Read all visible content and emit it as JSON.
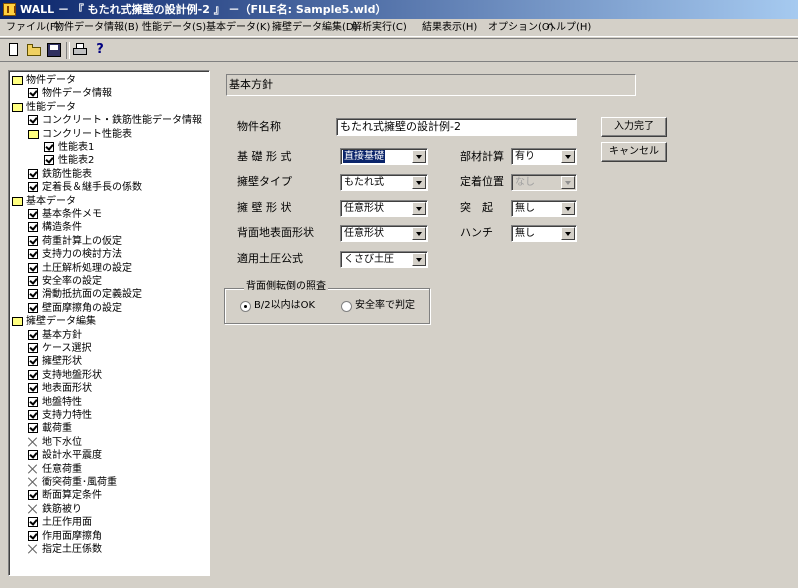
{
  "window": {
    "title": "WALL － 『 もたれ式擁壁の設計例-2 』 －（FILE名: Sample5.wld）"
  },
  "menu": [
    "ファイル(F)",
    "物件データ情報(B)",
    "性能データ(S)",
    "基本データ(K)",
    "擁壁データ編集(D)",
    "解析実行(C)",
    "結果表示(H)",
    "オプション(O)",
    "ヘルプ(H)"
  ],
  "tree": [
    {
      "label": "物件データ",
      "icon": "folder",
      "level": 0
    },
    {
      "label": "物件データ情報",
      "icon": "check",
      "level": 1
    },
    {
      "label": "性能データ",
      "icon": "folder",
      "level": 0
    },
    {
      "label": "コンクリート・鉄筋性能データ情報",
      "icon": "check",
      "level": 1
    },
    {
      "label": "コンクリート性能表",
      "icon": "folder",
      "level": 1
    },
    {
      "label": "性能表1",
      "icon": "check",
      "level": 2
    },
    {
      "label": "性能表2",
      "icon": "check",
      "level": 2
    },
    {
      "label": "鉄筋性能表",
      "icon": "check",
      "level": 1
    },
    {
      "label": "定着長＆継手長の係数",
      "icon": "check",
      "level": 1
    },
    {
      "label": "基本データ",
      "icon": "folder",
      "level": 0
    },
    {
      "label": "基本条件メモ",
      "icon": "check",
      "level": 1
    },
    {
      "label": "構造条件",
      "icon": "check",
      "level": 1
    },
    {
      "label": "荷重計算上の仮定",
      "icon": "check",
      "level": 1
    },
    {
      "label": "支持力の検討方法",
      "icon": "check",
      "level": 1
    },
    {
      "label": "土圧解析処理の設定",
      "icon": "check",
      "level": 1
    },
    {
      "label": "安全率の設定",
      "icon": "check",
      "level": 1
    },
    {
      "label": "滑動抵抗面の定義設定",
      "icon": "check",
      "level": 1
    },
    {
      "label": "壁面摩擦角の設定",
      "icon": "check",
      "level": 1
    },
    {
      "label": "擁壁データ編集",
      "icon": "folder",
      "level": 0
    },
    {
      "label": "基本方針",
      "icon": "check",
      "level": 1
    },
    {
      "label": "ケース選択",
      "icon": "check",
      "level": 1
    },
    {
      "label": "擁壁形状",
      "icon": "check",
      "level": 1
    },
    {
      "label": "支持地盤形状",
      "icon": "check",
      "level": 1
    },
    {
      "label": "地表面形状",
      "icon": "check",
      "level": 1
    },
    {
      "label": "地盤特性",
      "icon": "check",
      "level": 1
    },
    {
      "label": "支持力特性",
      "icon": "check",
      "level": 1
    },
    {
      "label": "載荷重",
      "icon": "check",
      "level": 1
    },
    {
      "label": "地下水位",
      "icon": "x",
      "level": 1
    },
    {
      "label": "設計水平震度",
      "icon": "check",
      "level": 1
    },
    {
      "label": "任意荷重",
      "icon": "x",
      "level": 1
    },
    {
      "label": "衝突荷重･風荷重",
      "icon": "x",
      "level": 1
    },
    {
      "label": "断面算定条件",
      "icon": "check",
      "level": 1
    },
    {
      "label": "鉄筋被り",
      "icon": "x",
      "level": 1
    },
    {
      "label": "土圧作用面",
      "icon": "check",
      "level": 1
    },
    {
      "label": "作用面摩擦角",
      "icon": "check",
      "level": 1
    },
    {
      "label": "指定土圧係数",
      "icon": "x",
      "level": 1
    }
  ],
  "form": {
    "heading": "基本方針",
    "property_name_label": "物件名称",
    "property_name_value": "もたれ式擁壁の設計例-2",
    "btn_done": "入力完了",
    "btn_cancel": "キャンセル",
    "foundation_label": "基 礎 形 式",
    "foundation_value": "直接基礎",
    "wall_type_label": "擁壁タイプ",
    "wall_type_value": "もたれ式",
    "wall_shape_label": "擁 壁 形 状",
    "wall_shape_value": "任意形状",
    "back_surface_label": "背面地表面形状",
    "back_surface_value": "任意形状",
    "earth_formula_label": "適用土圧公式",
    "earth_formula_value": "くさび土圧",
    "member_calc_label": "部材計算",
    "member_calc_value": "有り",
    "anchor_label": "定着位置",
    "anchor_value": "なし",
    "protrusion_label": "突　起",
    "protrusion_value": "無し",
    "haunch_label": "ハンチ",
    "haunch_value": "無し",
    "group_title": "背面側転倒の照査",
    "radio1": "B/2以内はOK",
    "radio2": "安全率で判定"
  }
}
